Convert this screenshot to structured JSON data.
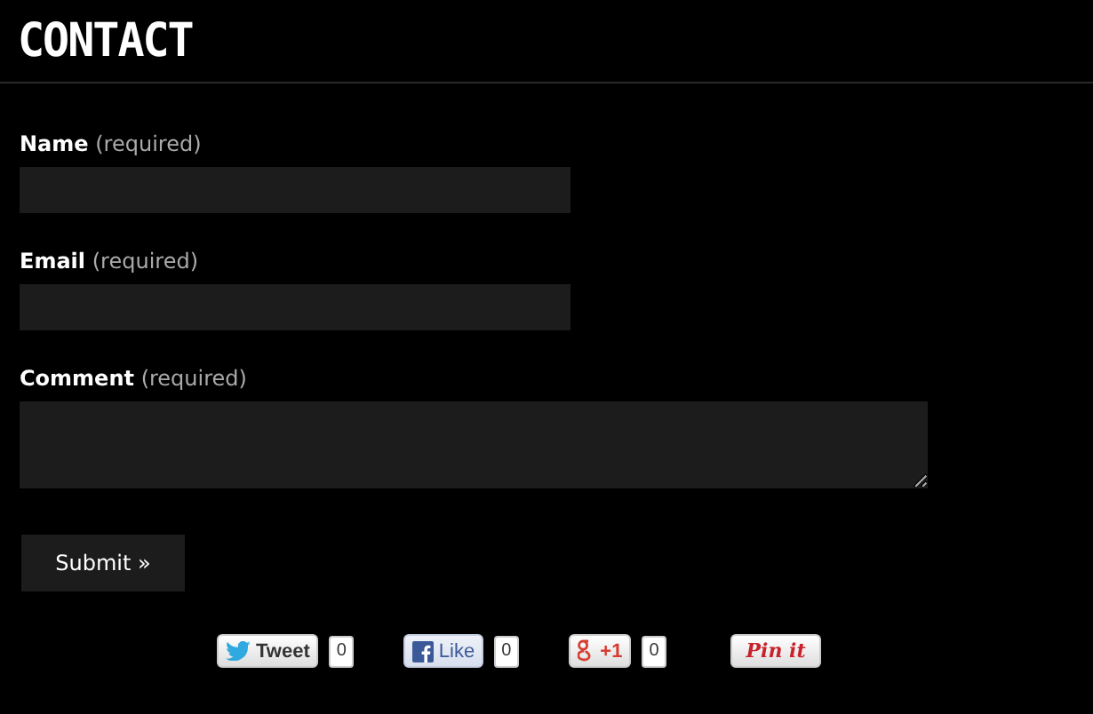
{
  "heading": "CONTACT",
  "fields": [
    {
      "kind": "input",
      "label": "Name",
      "hint": "(required)"
    },
    {
      "kind": "input",
      "label": "Email",
      "hint": "(required)"
    },
    {
      "kind": "textarea",
      "label": "Comment",
      "hint": "(required)"
    }
  ],
  "submit": "Submit »",
  "social": [
    {
      "kind": "tweet",
      "label": "Tweet",
      "count": "0"
    },
    {
      "kind": "like",
      "label": "Like",
      "count": "0"
    },
    {
      "kind": "plusone",
      "label": "+1",
      "count": "0"
    },
    {
      "kind": "pin",
      "label": "Pin it"
    }
  ]
}
